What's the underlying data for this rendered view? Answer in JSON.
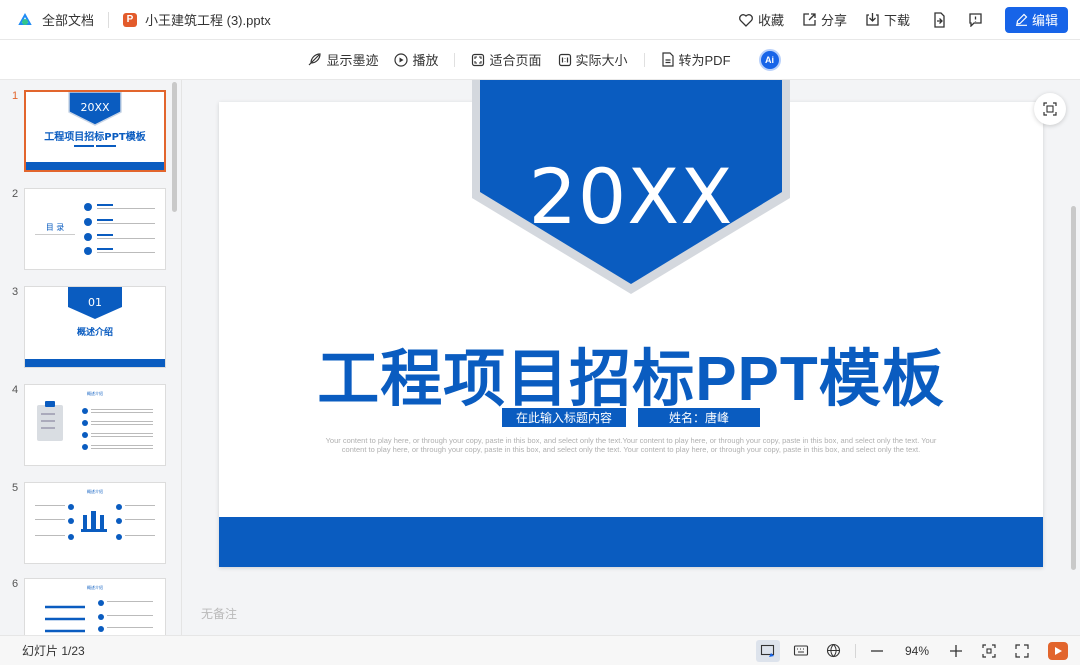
{
  "header": {
    "all_docs": "全部文档",
    "file_badge": "P",
    "file_name": "小王建筑工程 (3).pptx",
    "actions": {
      "favorite": "收藏",
      "share": "分享",
      "download": "下载"
    },
    "edit_label": "编辑"
  },
  "toolbar": {
    "show_ink": "显示墨迹",
    "play": "播放",
    "fit_page": "适合页面",
    "actual_size": "实际大小",
    "to_pdf": "转为PDF",
    "ai_label": "Ai"
  },
  "thumbnails": {
    "numbers": [
      "1",
      "2",
      "3",
      "4",
      "5",
      "6"
    ],
    "t1_badge": "20XX",
    "t1_title": "工程项目招标PPT模板",
    "t2_title": "目 录",
    "t3_badge": "01",
    "t3_title": "概述介绍",
    "t4_title": "概述介绍",
    "t5_title": "概述介绍",
    "t6_title": "概述介绍"
  },
  "slide": {
    "badge": "20XX",
    "title": "工程项目招标PPT模板",
    "pill_left": "在此输入标题内容",
    "pill_right": "姓名：唐峰",
    "body": "Your content to play here, or through your copy, paste in this box, and select only the text.Your content to play here, or through your copy, paste in this box, and select only the text. Your content to play here, or through your copy, paste in this box, and select only the text. Your content to play here, or through your copy, paste in this box, and select only the text."
  },
  "notes": "无备注",
  "status": {
    "slide_count": "幻灯片 1/23",
    "zoom": "94%"
  },
  "colors": {
    "brand_blue": "#0a5cc0",
    "accent_orange": "#e2652d",
    "edit_blue": "#1764e8"
  }
}
